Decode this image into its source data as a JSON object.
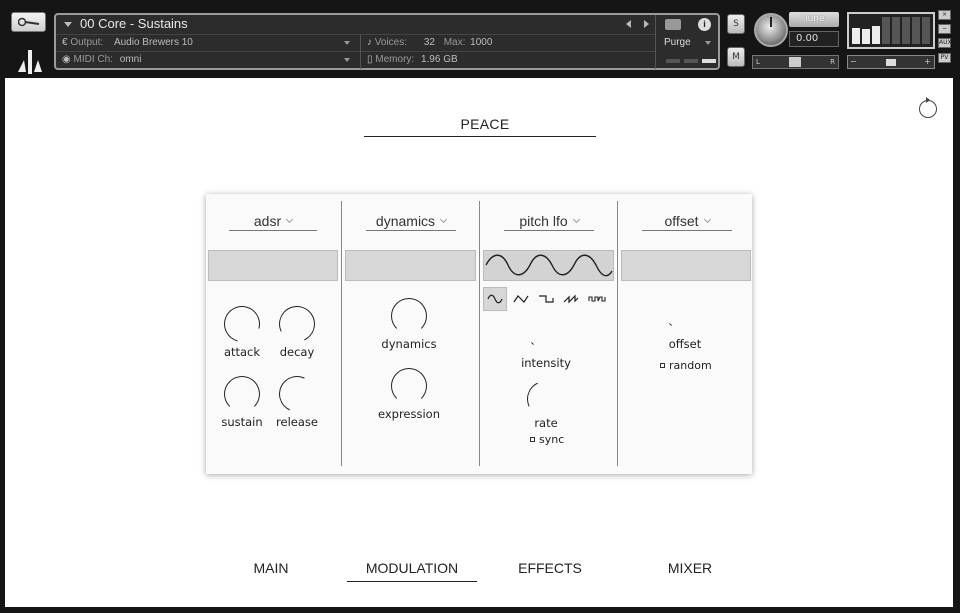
{
  "instrument": {
    "name": "00 Core - Sustains",
    "output_label": "Output:",
    "output_value": "Audio Brewers 10",
    "midi_label": "MIDI Ch:",
    "midi_value": "omni",
    "voices_label": "Voices:",
    "voices_value": "32",
    "max_label": "Max:",
    "max_value": "1000",
    "memory_label": "Memory:",
    "memory_value": "1.96 GB",
    "purge_label": "Purge"
  },
  "controls": {
    "solo": "S",
    "mute": "M",
    "tune_label": "Tune",
    "tune_value": "0.00",
    "pan_left": "L",
    "pan_right": "R",
    "aux": "AUX",
    "pv": "PV",
    "close": "×",
    "minimize": "−"
  },
  "main": {
    "preset_name": "PEACE",
    "columns": {
      "adsr": {
        "dropdown": "adsr",
        "knobs": [
          "attack",
          "decay",
          "sustain",
          "release"
        ]
      },
      "dynamics": {
        "dropdown": "dynamics",
        "knobs": [
          "dynamics",
          "expression"
        ]
      },
      "pitch_lfo": {
        "dropdown": "pitch lfo",
        "wave_shapes": [
          "sine",
          "triangle",
          "square",
          "saw",
          "random"
        ],
        "selected_wave": "sine",
        "knobs": [
          "intensity",
          "rate"
        ],
        "sync_label": "sync"
      },
      "offset": {
        "dropdown": "offset",
        "knobs": [
          "offset"
        ],
        "random_label": "random"
      }
    },
    "tabs": [
      "MAIN",
      "MODULATION",
      "EFFECTS",
      "MIXER"
    ],
    "active_tab": "MODULATION"
  }
}
